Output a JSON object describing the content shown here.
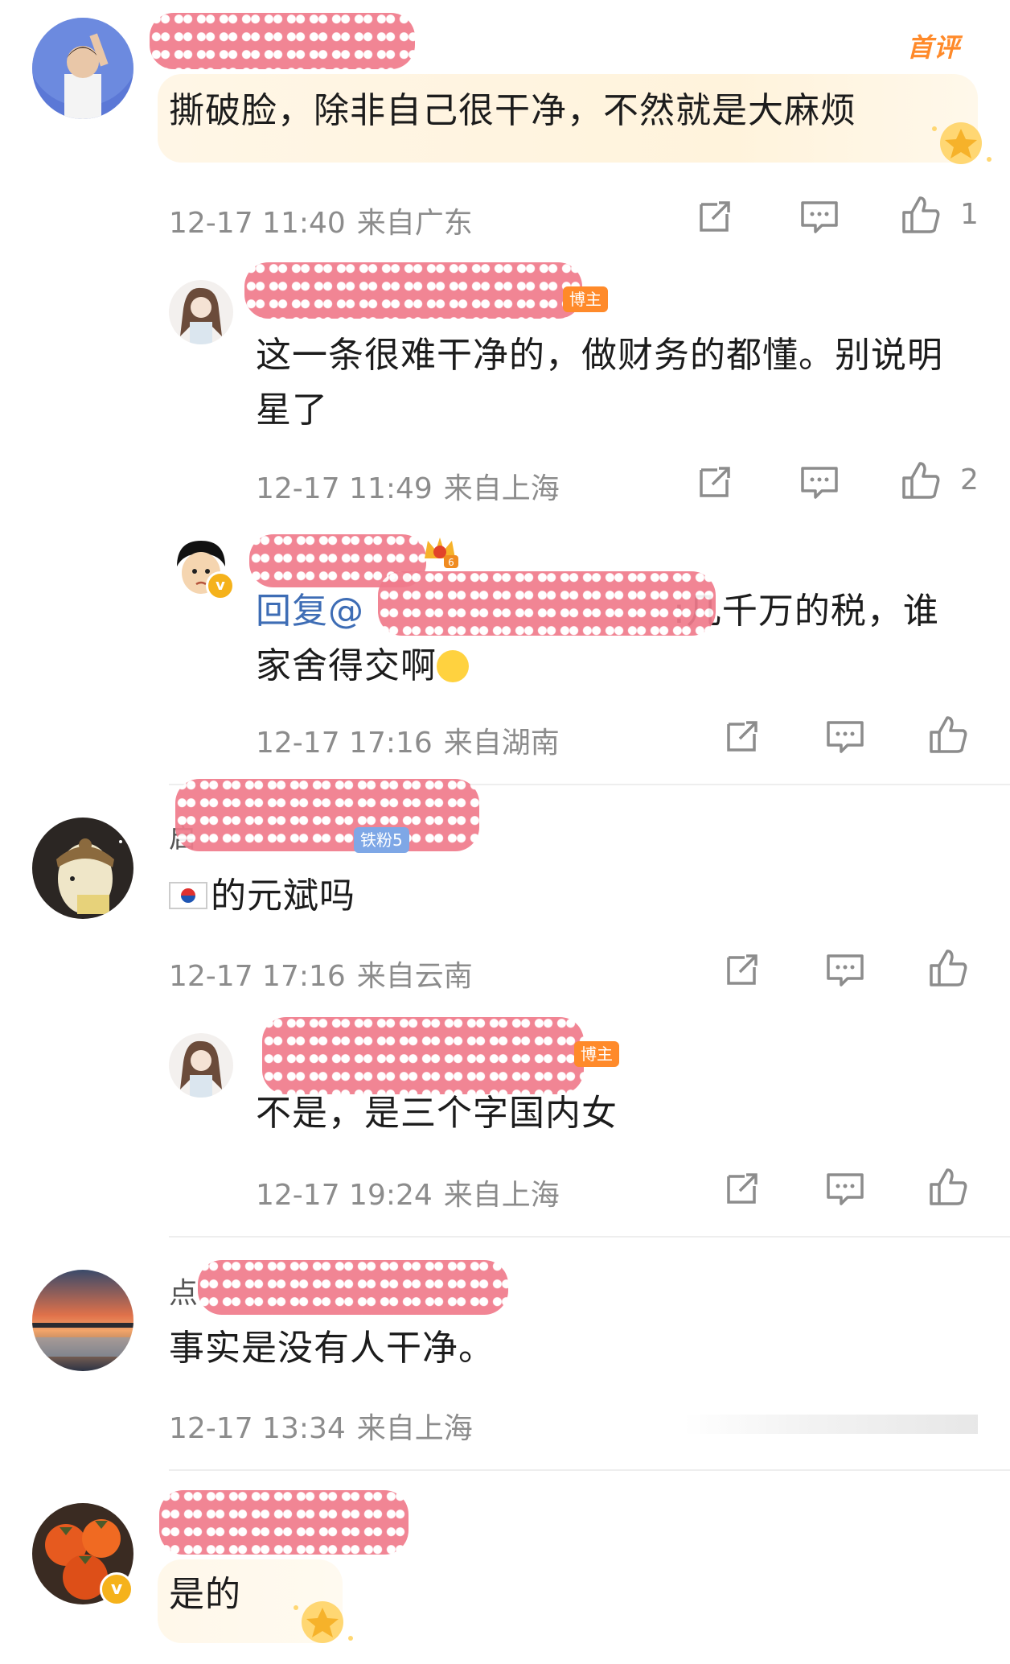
{
  "first_comment_badge": "首评",
  "comments": [
    {
      "text": "撕破脸，除非自己很干净，不然就是大麻烦",
      "time": "12-17 11:40",
      "location": "来自广东",
      "likes": "1",
      "replies": [
        {
          "tag": "博主",
          "text": "这一条很难干净的，做财务的都懂。别说明星了",
          "time": "12-17 11:49",
          "location": "来自上海",
          "likes": "2"
        },
        {
          "crown_level": "6",
          "reply_prefix": "回复@",
          "text_after": ":几千万的税，谁家舍得交啊",
          "time": "12-17 17:16",
          "location": "来自湖南"
        }
      ]
    },
    {
      "name_prefix": "启",
      "fan_tag": "铁粉5",
      "text": "的元斌吗",
      "time": "12-17 17:16",
      "location": "来自云南",
      "replies": [
        {
          "tag": "博主",
          "text": "不是，是三个字国内女",
          "time": "12-17 19:24",
          "location": "来自上海"
        }
      ]
    },
    {
      "name_prefix": "点",
      "text": "事实是没有人干净。",
      "time": "12-17 13:34",
      "location": "来自上海"
    },
    {
      "text": "是的"
    }
  ],
  "colors": {
    "accent_orange": "#ff8a2a",
    "mention_blue": "#3e6db5",
    "redaction_pink": "#f07b8c",
    "meta_gray": "#8c8c8c"
  }
}
